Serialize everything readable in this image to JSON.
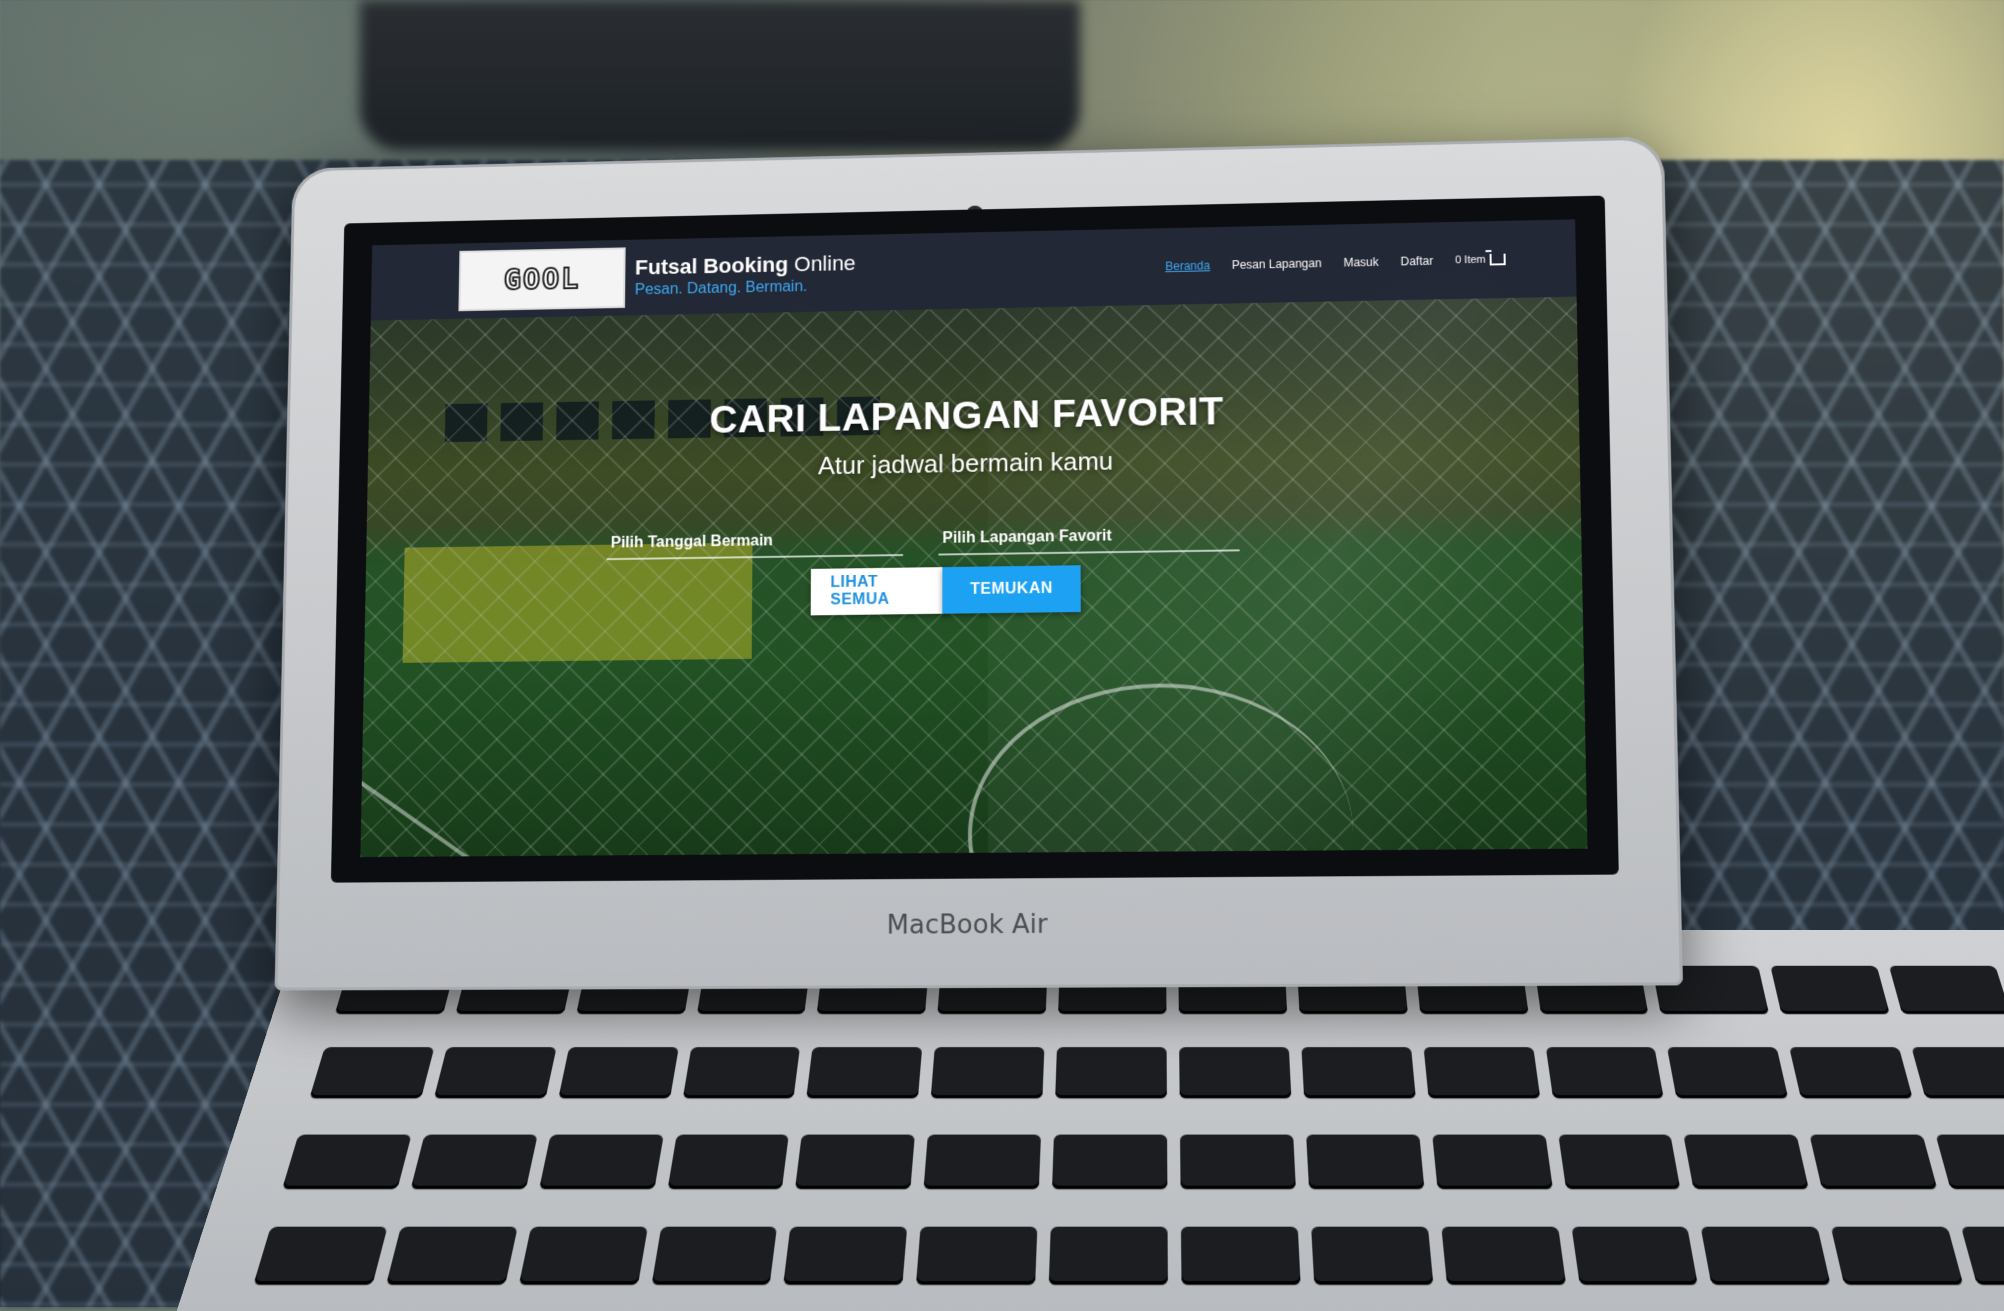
{
  "navbar": {
    "logo_text": "GOOL",
    "site_name_bold": "Futsal Booking",
    "site_name_light": "Online",
    "tagline": "Pesan. Datang. Bermain.",
    "links": [
      {
        "label": "Beranda",
        "active": true
      },
      {
        "label": "Pesan Lapangan",
        "active": false
      },
      {
        "label": "Masuk",
        "active": false
      },
      {
        "label": "Daftar",
        "active": false
      }
    ],
    "cart_label": "0 Item",
    "cart_icon": "cart-icon"
  },
  "hero": {
    "title": "CARI LAPANGAN FAVORIT",
    "subtitle": "Atur jadwal bermain kamu",
    "date_field_placeholder": "Pilih Tanggal Bermain",
    "court_field_placeholder": "Pilih Lapangan Favorit",
    "see_all_button": "LIHAT SEMUA",
    "find_button": "TEMUKAN"
  },
  "device": {
    "brand": "MacBook Air"
  },
  "colors": {
    "accent": "#1da1f2",
    "navbar": "#222836"
  }
}
